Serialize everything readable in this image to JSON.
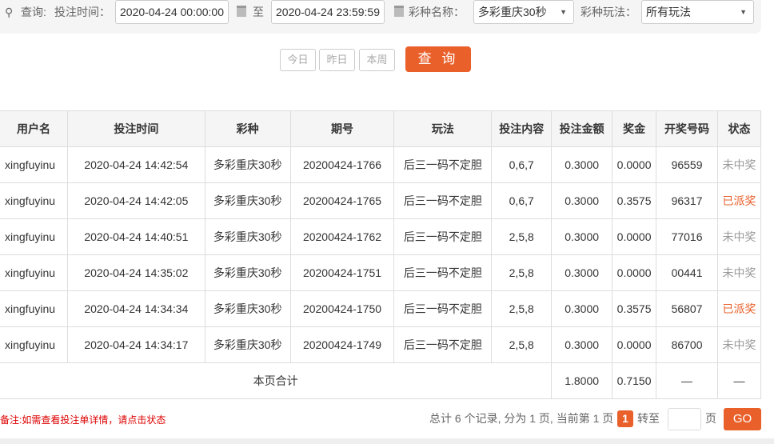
{
  "filter": {
    "query_label": "查询:",
    "time_label": "投注时间：",
    "start": "2020-04-24 00:00:00",
    "to": "至",
    "end": "2020-04-24 23:59:59",
    "lottery_label": "彩种名称：",
    "lottery": "多彩重庆30秒",
    "play_label": "彩种玩法：",
    "play": "所有玩法"
  },
  "buttons": {
    "today": "今日",
    "yesterday": "昨日",
    "week": "本周",
    "search": "查 询"
  },
  "table": {
    "headers": [
      "用户名",
      "投注时间",
      "彩种",
      "期号",
      "玩法",
      "投注内容",
      "投注金额",
      "奖金",
      "开奖号码",
      "状态"
    ],
    "rows": [
      [
        "xingfuyinu",
        "2020-04-24 14:42:54",
        "多彩重庆30秒",
        "20200424-1766",
        "后三一码不定胆",
        "0,6,7",
        "0.3000",
        "0.0000",
        "96559",
        "未中奖"
      ],
      [
        "xingfuyinu",
        "2020-04-24 14:42:05",
        "多彩重庆30秒",
        "20200424-1765",
        "后三一码不定胆",
        "0,6,7",
        "0.3000",
        "0.3575",
        "96317",
        "已派奖"
      ],
      [
        "xingfuyinu",
        "2020-04-24 14:40:51",
        "多彩重庆30秒",
        "20200424-1762",
        "后三一码不定胆",
        "2,5,8",
        "0.3000",
        "0.0000",
        "77016",
        "未中奖"
      ],
      [
        "xingfuyinu",
        "2020-04-24 14:35:02",
        "多彩重庆30秒",
        "20200424-1751",
        "后三一码不定胆",
        "2,5,8",
        "0.3000",
        "0.0000",
        "00441",
        "未中奖"
      ],
      [
        "xingfuyinu",
        "2020-04-24 14:34:34",
        "多彩重庆30秒",
        "20200424-1750",
        "后三一码不定胆",
        "2,5,8",
        "0.3000",
        "0.3575",
        "56807",
        "已派奖"
      ],
      [
        "xingfuyinu",
        "2020-04-24 14:34:17",
        "多彩重庆30秒",
        "20200424-1749",
        "后三一码不定胆",
        "2,5,8",
        "0.3000",
        "0.0000",
        "86700",
        "未中奖"
      ]
    ],
    "total": {
      "label": "本页合计",
      "amount": "1.8000",
      "prize": "0.7150",
      "number": "—",
      "status": "—"
    }
  },
  "footer": {
    "note": "备注:如需查看投注单详情，请点击状态",
    "summary": "总计 6 个记录, 分为 1 页, 当前第 1 页",
    "page": "1",
    "goto": "转至",
    "page_unit": "页",
    "go": "GO"
  }
}
